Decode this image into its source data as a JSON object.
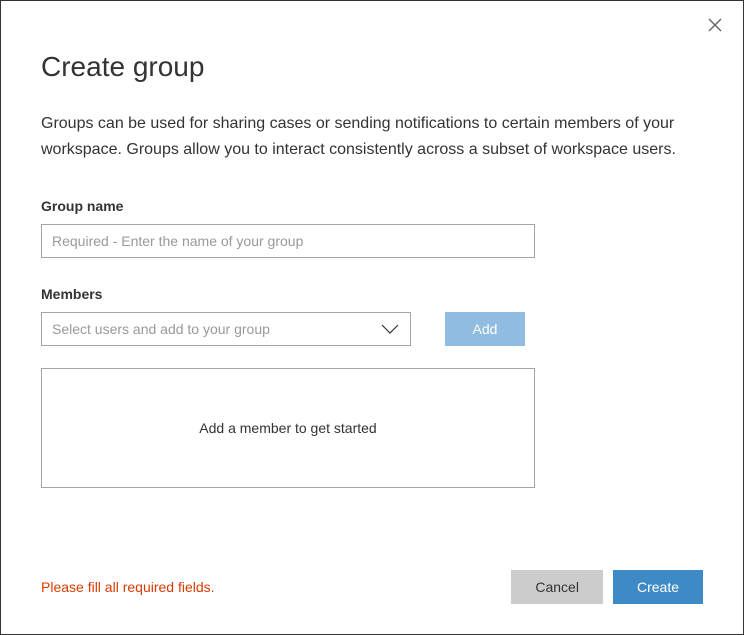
{
  "dialog": {
    "title": "Create group",
    "description": "Groups can be used for sharing cases or sending notifications to certain members of your workspace. Groups allow you to interact consistently across a subset of workspace users."
  },
  "fields": {
    "groupName": {
      "label": "Group name",
      "placeholder": "Required - Enter the name of your group",
      "value": ""
    },
    "members": {
      "label": "Members",
      "dropdownPlaceholder": "Select users and add to your group",
      "addButtonLabel": "Add",
      "emptyStateText": "Add a member to get started"
    }
  },
  "footer": {
    "errorMessage": "Please fill all required fields.",
    "cancelLabel": "Cancel",
    "createLabel": "Create"
  }
}
